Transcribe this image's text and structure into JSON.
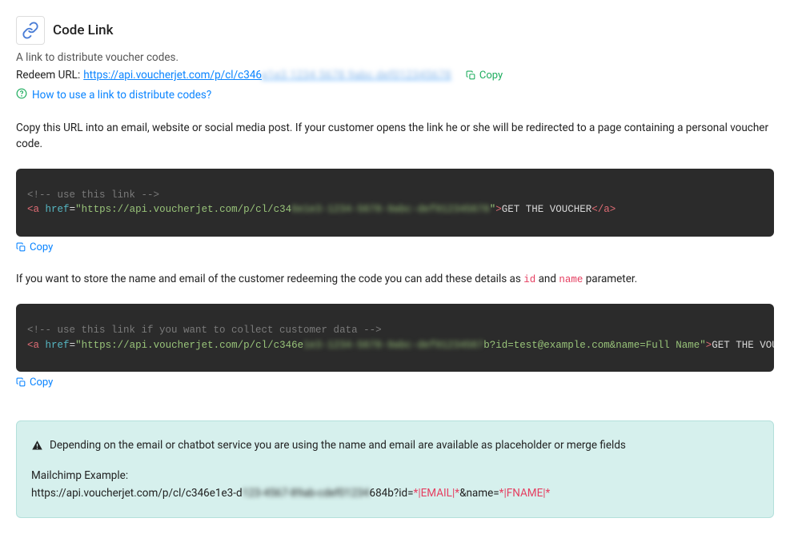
{
  "header": {
    "title": "Code Link",
    "subtitle": "A link to distribute voucher codes.",
    "redeem_label": "Redeem URL:",
    "redeem_url_visible": "https://api.voucherjet.com/p/cl/c346",
    "redeem_url_blurred": "e1e3 1234 5678 9abc def012345678",
    "copy_label": "Copy",
    "help_text": "How to use a link to distribute codes?"
  },
  "para1": "Copy this URL into an email, website or social media post. If your customer opens the link he or she will be redirected to a page containing a personal voucher code.",
  "code1": {
    "comment": "<!-- use this link -->",
    "tag_open": "<",
    "tag_name": "a",
    "attr_name": "href",
    "eq": "=",
    "q": "\"",
    "url_visible": "https://api.voucherjet.com/p/cl/c34",
    "url_blurred": "6e1e3-1234-5678-9abc-def012345678",
    "close1": "\">",
    "link_text": "GET THE VOUCHER",
    "tag_close_open": "</",
    "tag_close_gt": ">"
  },
  "copy_label": "Copy",
  "para2_pre": "If you want to store the name and email of the customer redeeming the code you can add these details as ",
  "para2_id": "id",
  "para2_and": " and ",
  "para2_name": "name",
  "para2_post": " parameter.",
  "code2": {
    "comment": "<!-- use this link if you want to collect customer data -->",
    "url_visible": "https://api.voucherjet.com/p/cl/c346e",
    "url_blurred": "1e3-1234-5678-9abc-def01234567",
    "url_query": "b?id=test@example.com&name=Full Name",
    "link_text": "GET THE VOUCHER"
  },
  "info": {
    "line1": "Depending on the email or chatbot service you are using the name and email are available as placeholder or merge fields",
    "example_label": "Mailchimp Example:",
    "url_pre": "https://api.voucherjet.com/p/cl/c346e1e3-d",
    "url_blurred": "123-4567-89ab-cdef01234",
    "url_post": "684b?id=",
    "tag_email": "*|EMAIL|*",
    "amp_name": "&name=",
    "tag_fname": "*|FNAME|*"
  }
}
